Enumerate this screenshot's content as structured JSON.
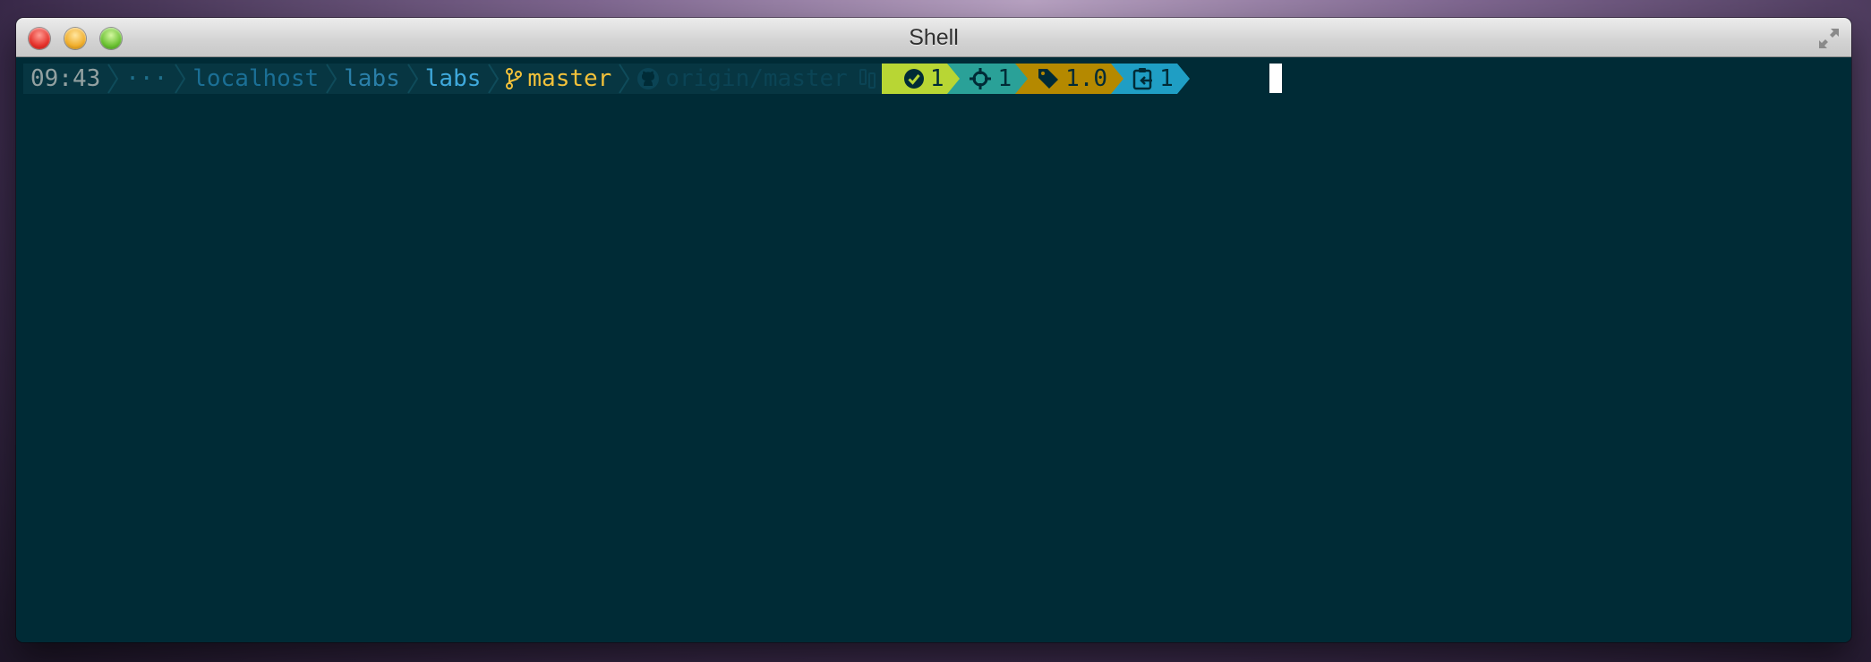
{
  "window": {
    "title": "Shell"
  },
  "prompt": {
    "time": "09:43",
    "ellipsis": "···",
    "host": "localhost",
    "dir1": "labs",
    "dir2": "labs",
    "branch_icon": "git-branch-icon",
    "branch": "master",
    "remote_icon": "github-icon",
    "remote": "origin/master",
    "sync_icon": "git-compare-icon",
    "badges": [
      {
        "icon": "check-circle-icon",
        "value": "1",
        "color": "#b8d634"
      },
      {
        "icon": "crosshair-icon",
        "value": "1",
        "color": "#2aa198"
      },
      {
        "icon": "tag-icon",
        "value": "1.0",
        "color": "#b58900"
      },
      {
        "icon": "clipboard-icon",
        "value": "1",
        "color": "#1f9ec4"
      }
    ]
  },
  "colors": {
    "terminal_bg": "#002b36",
    "segment_bg": "#073642",
    "branch": "#f2c13a",
    "cursor": "#ffffff"
  }
}
